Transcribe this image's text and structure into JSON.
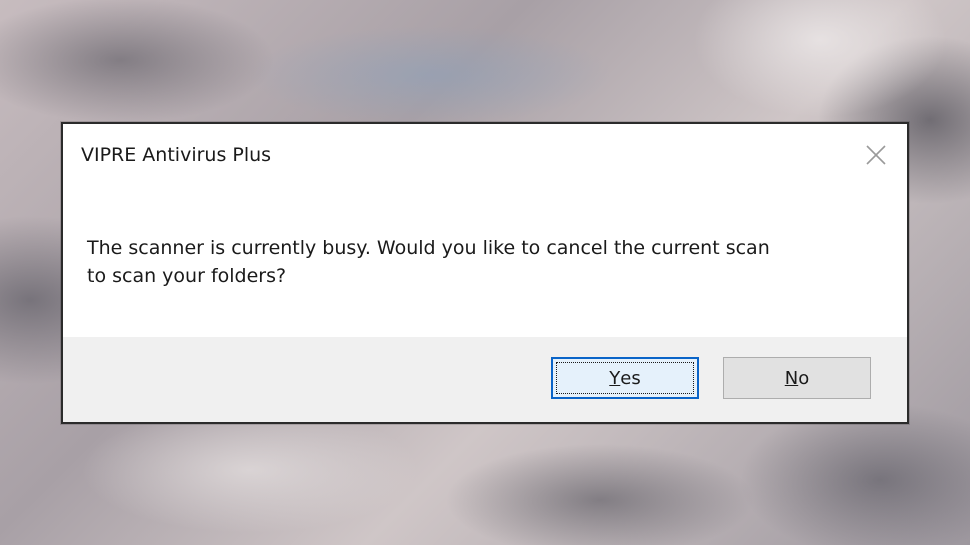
{
  "dialog": {
    "title": "VIPRE Antivirus Plus",
    "close_icon": "close-icon",
    "message_line1": "The scanner is currently busy. Would you like to cancel the current scan",
    "message_line2": "to scan your folders?"
  },
  "buttons": {
    "yes": {
      "accel": "Y",
      "rest": "es"
    },
    "no": {
      "accel": "N",
      "rest": "o"
    }
  }
}
